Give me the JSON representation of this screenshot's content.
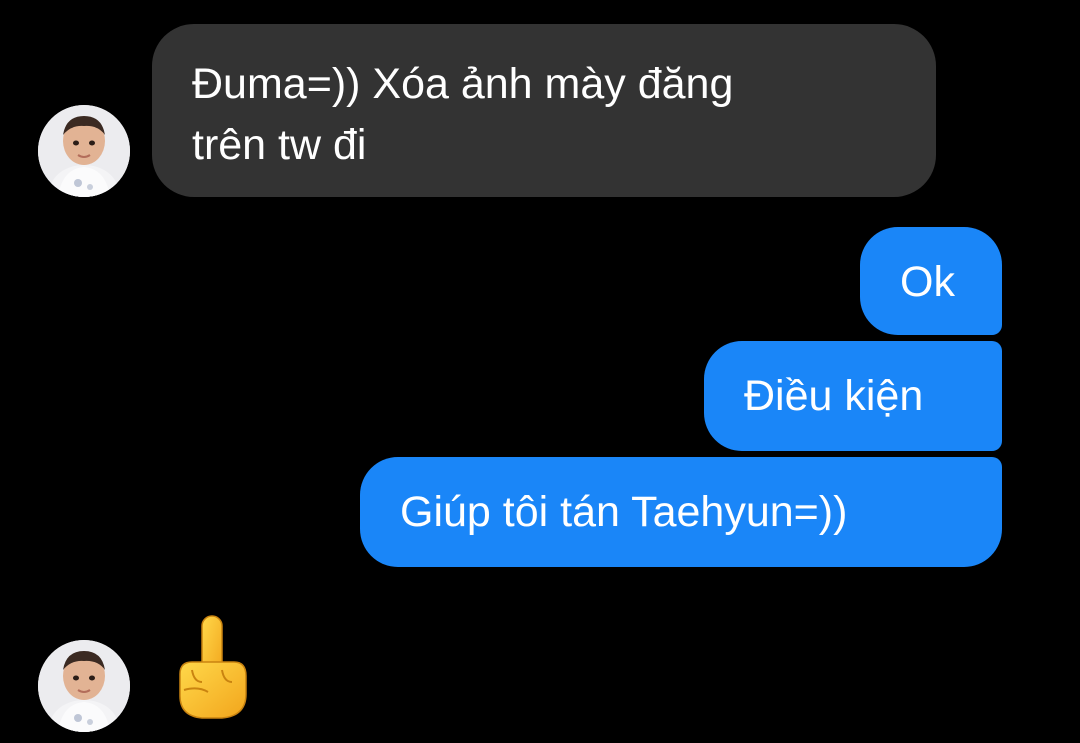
{
  "conversation": {
    "incoming_message": "Đuma=)) Xóa ảnh mày đăng\ntrên tw đi",
    "outgoing_messages": [
      "Ok",
      "Điều kiện",
      "Giúp tôi tán Taehyun=))"
    ],
    "reaction_emoji": "middle-finger-icon"
  },
  "colors": {
    "background": "#000000",
    "incoming_bubble": "#333333",
    "outgoing_bubble": "#1a86f8",
    "text": "#ffffff"
  }
}
